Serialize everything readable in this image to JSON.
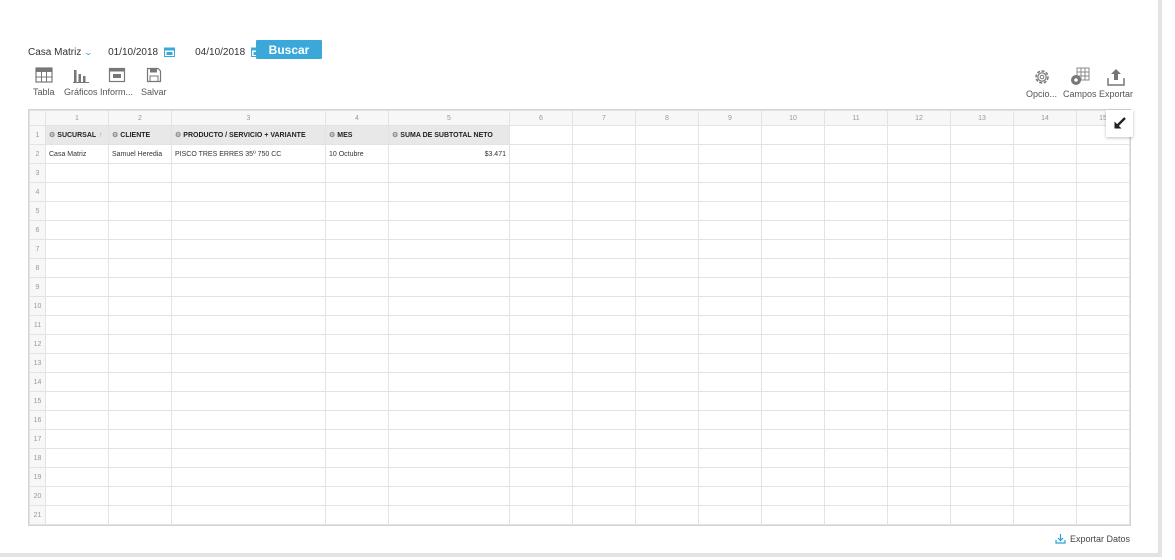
{
  "filters": {
    "branch": "Casa Matriz",
    "date_from": "01/10/2018",
    "date_to": "04/10/2018",
    "search_label": "Buscar"
  },
  "toolbar": {
    "left": [
      {
        "label": "Tabla",
        "icon": "table-icon"
      },
      {
        "label": "Gráficos",
        "icon": "bar-chart-icon"
      },
      {
        "label": "Inform...",
        "icon": "report-icon"
      },
      {
        "label": "Salvar",
        "icon": "save-icon"
      }
    ],
    "right": [
      {
        "label": "Opcio...",
        "icon": "gear-icon"
      },
      {
        "label": "Campos",
        "icon": "fields-icon"
      },
      {
        "label": "Exportar",
        "icon": "export-icon"
      }
    ]
  },
  "grid": {
    "column_numbers": [
      "1",
      "2",
      "3",
      "4",
      "5",
      "6",
      "7",
      "8",
      "9",
      "10",
      "11",
      "12",
      "13",
      "14",
      "15"
    ],
    "row_numbers": [
      "1",
      "2",
      "3",
      "4",
      "5",
      "6",
      "7",
      "8",
      "9",
      "10",
      "11",
      "12",
      "13",
      "14",
      "15",
      "16",
      "17",
      "18",
      "19",
      "20",
      "21"
    ],
    "headers": [
      "SUCURSAL",
      "CLIENTE",
      "PRODUCTO / SERVICIO + VARIANTE",
      "MES",
      "SUMA DE SUBTOTAL NETO"
    ],
    "rows": [
      [
        "Casa Matriz",
        "Samuel Heredia",
        "PISCO TRES ERRES 35º 750 CC",
        "10 Octubre",
        "$3.471"
      ]
    ]
  },
  "export_data_label": "Exportar Datos",
  "colors": {
    "accent": "#3aa9da",
    "header_bg": "#e8e8e8",
    "grid_line": "#e3e3e3"
  }
}
